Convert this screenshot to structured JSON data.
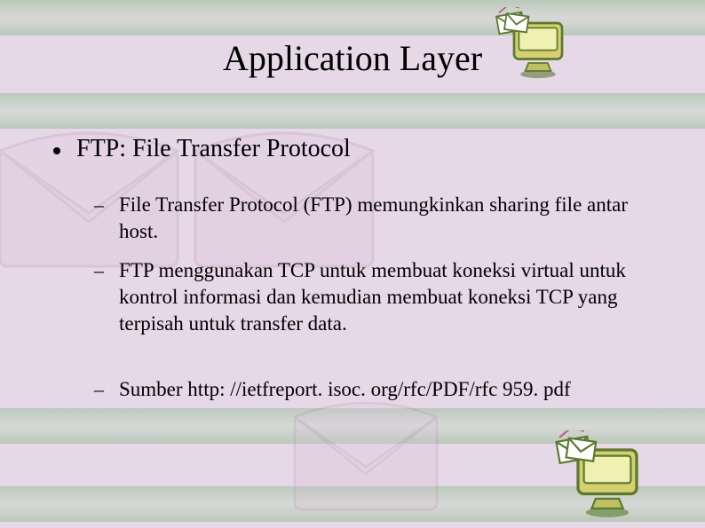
{
  "title": "Application Layer",
  "main": {
    "heading": "FTP: File Transfer Protocol",
    "items": [
      "File Transfer Protocol (FTP) memungkinkan sharing file antar host.",
      "FTP menggunakan TCP untuk membuat koneksi virtual untuk kontrol informasi dan kemudian membuat koneksi TCP yang terpisah untuk transfer data.",
      "Sumber http: //ietfreport. isoc. org/rfc/PDF/rfc 959. pdf"
    ]
  }
}
